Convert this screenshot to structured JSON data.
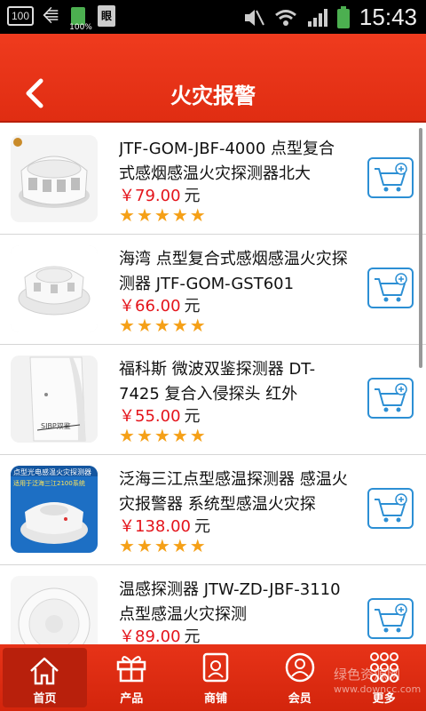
{
  "status_bar": {
    "notification_badge": "100",
    "battery_small_pct": "100%",
    "doc_icon_text": "眼",
    "time": "15:43"
  },
  "header": {
    "title": "火灾报警"
  },
  "products": [
    {
      "name": "JTF-GOM-JBF-4000 点型复合式感烟感温火灾探测器北大",
      "price": "￥79.00",
      "unit": "元",
      "rating": 5
    },
    {
      "name": "海湾 点型复合式感烟感温火灾探测器 JTF-GOM-GST601",
      "price": "￥66.00",
      "unit": "元",
      "rating": 5
    },
    {
      "name": "福科斯 微波双鉴探测器 DT-7425 复合入侵探头 红外",
      "price": "￥55.00",
      "unit": "元",
      "rating": 5
    },
    {
      "name": "泛海三江点型感温探测器 感温火灾报警器 系统型感温火灾探",
      "price": "￥138.00",
      "unit": "元",
      "rating": 5
    },
    {
      "name": "温感探测器 JTW-ZD-JBF-3110点型感温火灾探测",
      "price": "￥89.00",
      "unit": "元",
      "rating": 5
    }
  ],
  "thumb_texts": {
    "p4_top": "点型光电感温火灾探测器",
    "p4_sub": "适用于泛海三江2100系统",
    "p3_label": "SIBP双鉴"
  },
  "nav": [
    {
      "label": "首页",
      "icon": "home-icon"
    },
    {
      "label": "产品",
      "icon": "gift-icon"
    },
    {
      "label": "商铺",
      "icon": "shop-icon"
    },
    {
      "label": "会员",
      "icon": "user-icon"
    },
    {
      "label": "更多",
      "icon": "grid-icon"
    }
  ],
  "watermark": {
    "line1": "绿色资源网",
    "line2": "www.downcc.com"
  },
  "colors": {
    "header": "#e4361a",
    "price": "#e4141b",
    "star": "#f5a017",
    "cart_border": "#2c8fd4"
  }
}
